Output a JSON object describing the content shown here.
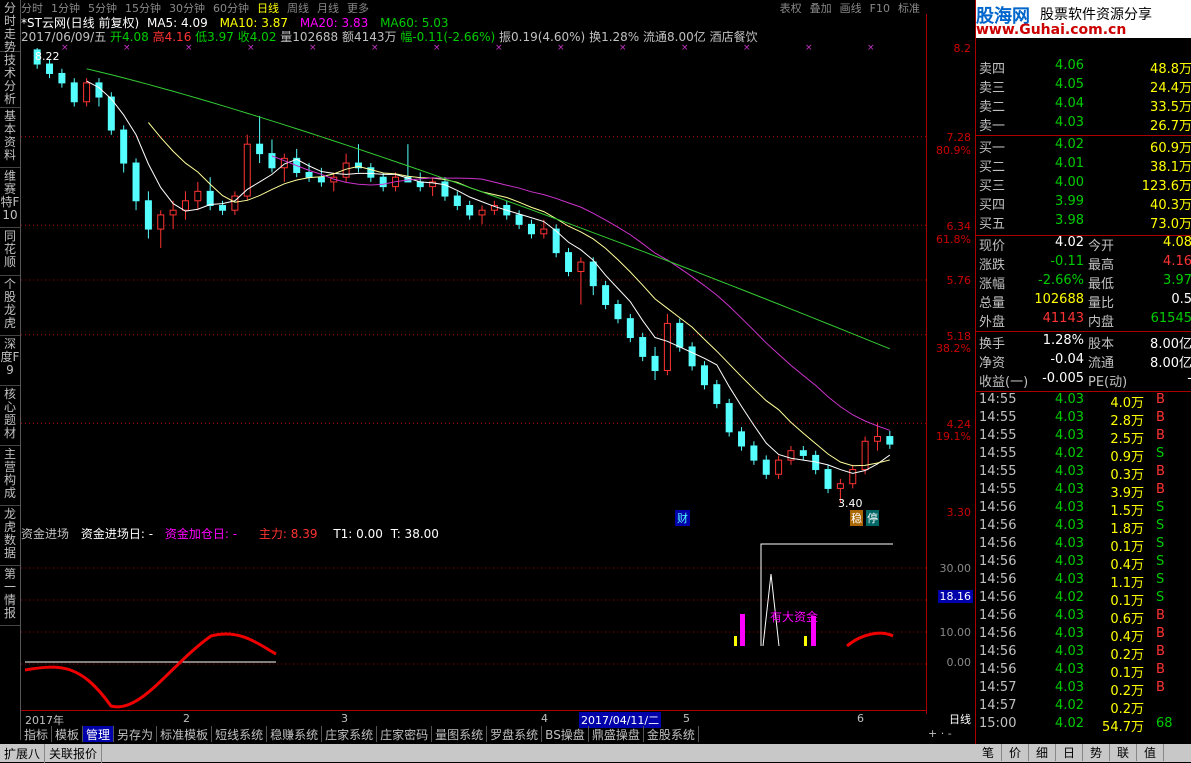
{
  "left_tabs": [
    "分时走势",
    "技术分析",
    "基本资料",
    "维赛特F10",
    "同花顺",
    "个股龙虎",
    "深度F9",
    "核心题材",
    "主营构成",
    "龙虎数据",
    "第一情报"
  ],
  "top_menu": {
    "items": [
      "分时",
      "1分钟",
      "5分钟",
      "15分钟",
      "30分钟",
      "60分钟",
      "日线",
      "周线",
      "月线",
      "更多"
    ],
    "active": "日线",
    "right": [
      "表权",
      "叠加",
      "画线",
      "F10",
      "标准"
    ]
  },
  "chart_header": {
    "line1": {
      "name": "*ST云网(日线 前复权)",
      "ma5": "MA5: 4.09",
      "ma10": "MA10: 3.87",
      "ma20": "MA20: 3.83",
      "ma60": "MA60: 5.03"
    },
    "line2": {
      "date": "2017/06/09/五",
      "open": "开4.08",
      "high": "高4.16",
      "low": "低3.97",
      "close": "收4.02",
      "vol": "量102688",
      "amount": "额4143万",
      "change": "幅-0.11(-2.66%)",
      "amp": "振0.19(4.60%)",
      "turnover": "换1.28%",
      "float": "流通8.00亿",
      "sector": "酒店餐饮"
    }
  },
  "price_axis": {
    "labels": [
      "8.2",
      "7.28",
      "80.9%",
      "6.34",
      "61.8%",
      "5.76",
      "5.18",
      "38.2%",
      "4.24",
      "19.1%",
      "3.30"
    ]
  },
  "annotations": {
    "high_label": "8.22",
    "low_label": "3.40",
    "fin_tag": "财",
    "stable_tag": "稳",
    "stop_tag": "停"
  },
  "indicator": {
    "title": "资金进场",
    "enter_day": "资金进场日: -",
    "add_day": "资金加仓日: -",
    "main": "主力: 8.39",
    "t1": "T1: 0.00",
    "t": "T: 38.00",
    "axis": [
      "30.00",
      "18.16",
      "10.00",
      "0.00"
    ],
    "annotation": "有大资金"
  },
  "x_axis": {
    "labels": [
      "2017年",
      "2",
      "3",
      "4",
      "2017/04/11/二",
      "5",
      "6"
    ],
    "period": "日线"
  },
  "bottom_tabs": [
    "指标",
    "模板",
    "管理",
    "另存为",
    "标准模板",
    "短线系统",
    "稳赚系统",
    "庄家系统",
    "庄家密码",
    "量图系统",
    "罗盘系统",
    "BS操盘",
    "鼎盛操盘",
    "金股系统"
  ],
  "bottom_tabs_selected": "管理",
  "status_bar": [
    "扩展八",
    "关联报价"
  ],
  "logo": {
    "brand": "股海网",
    "tagline": "股票软件资源分享",
    "url": "www.Guhai.com.cn"
  },
  "order_book": {
    "sell": [
      {
        "label": "卖四",
        "price": "4.06",
        "vol": "48.8万"
      },
      {
        "label": "卖三",
        "price": "4.05",
        "vol": "24.4万"
      },
      {
        "label": "卖二",
        "price": "4.04",
        "vol": "33.5万"
      },
      {
        "label": "卖一",
        "price": "4.03",
        "vol": "26.7万"
      }
    ],
    "buy": [
      {
        "label": "买一",
        "price": "4.02",
        "vol": "60.9万"
      },
      {
        "label": "买二",
        "price": "4.01",
        "vol": "38.1万"
      },
      {
        "label": "买三",
        "price": "4.00",
        "vol": "123.6万"
      },
      {
        "label": "买四",
        "price": "3.99",
        "vol": "40.3万"
      },
      {
        "label": "买五",
        "price": "3.98",
        "vol": "73.0万"
      }
    ]
  },
  "quote": [
    {
      "l1": "现价",
      "v1": "4.02",
      "l2": "今开",
      "v2": "4.08"
    },
    {
      "l1": "涨跌",
      "v1": "-0.11",
      "l2": "最高",
      "v2": "4.16"
    },
    {
      "l1": "涨幅",
      "v1": "-2.66%",
      "l2": "最低",
      "v2": "3.97"
    },
    {
      "l1": "总量",
      "v1": "102688",
      "l2": "量比",
      "v2": "0.5"
    },
    {
      "l1": "外盘",
      "v1": "41143",
      "l2": "内盘",
      "v2": "61545"
    },
    {
      "l1": "换手",
      "v1": "1.28%",
      "l2": "股本",
      "v2": "8.00亿"
    },
    {
      "l1": "净资",
      "v1": "-0.04",
      "l2": "流通",
      "v2": "8.00亿"
    },
    {
      "l1": "收益(一)",
      "v1": "-0.005",
      "l2": "PE(动)",
      "v2": "-"
    }
  ],
  "ticks": [
    {
      "t": "14:55",
      "p": "4.03",
      "v": "4.0万",
      "s": "B"
    },
    {
      "t": "14:55",
      "p": "4.03",
      "v": "2.8万",
      "s": "B"
    },
    {
      "t": "14:55",
      "p": "4.03",
      "v": "2.5万",
      "s": "B"
    },
    {
      "t": "14:55",
      "p": "4.02",
      "v": "0.9万",
      "s": "S"
    },
    {
      "t": "14:55",
      "p": "4.03",
      "v": "0.3万",
      "s": "B"
    },
    {
      "t": "14:55",
      "p": "4.03",
      "v": "3.9万",
      "s": "B"
    },
    {
      "t": "14:56",
      "p": "4.03",
      "v": "1.5万",
      "s": "S"
    },
    {
      "t": "14:56",
      "p": "4.03",
      "v": "1.8万",
      "s": "S"
    },
    {
      "t": "14:56",
      "p": "4.03",
      "v": "0.1万",
      "s": "S"
    },
    {
      "t": "14:56",
      "p": "4.03",
      "v": "0.4万",
      "s": "S"
    },
    {
      "t": "14:56",
      "p": "4.03",
      "v": "1.1万",
      "s": "S"
    },
    {
      "t": "14:56",
      "p": "4.02",
      "v": "0.1万",
      "s": "S"
    },
    {
      "t": "14:56",
      "p": "4.03",
      "v": "0.6万",
      "s": "B"
    },
    {
      "t": "14:56",
      "p": "4.03",
      "v": "0.4万",
      "s": "B"
    },
    {
      "t": "14:56",
      "p": "4.03",
      "v": "0.2万",
      "s": "B"
    },
    {
      "t": "14:56",
      "p": "4.03",
      "v": "0.1万",
      "s": "B"
    },
    {
      "t": "14:57",
      "p": "4.03",
      "v": "0.2万",
      "s": "B"
    },
    {
      "t": "14:57",
      "p": "4.02",
      "v": "0.2万",
      "s": ""
    },
    {
      "t": "15:00",
      "p": "4.02",
      "v": "54.7万",
      "s": "68"
    }
  ],
  "right_tabs": [
    "笔",
    "价",
    "细",
    "日",
    "势",
    "联",
    "值"
  ],
  "colors": {
    "up": "#f33",
    "down": "#5ff",
    "ma5": "#fff",
    "ma10": "#ff9",
    "ma20": "#c3c",
    "ma60": "#3c3",
    "grid": "#a00"
  },
  "chart_data": {
    "type": "candlestick",
    "x": [
      "2017-01-03",
      "2017-06-09"
    ],
    "ohlc": [
      [
        8.2,
        8.22,
        8.0,
        8.05
      ],
      [
        8.05,
        8.1,
        7.9,
        7.95
      ],
      [
        7.95,
        8.0,
        7.8,
        7.85
      ],
      [
        7.85,
        7.9,
        7.6,
        7.65
      ],
      [
        7.65,
        7.9,
        7.6,
        7.85
      ],
      [
        7.85,
        7.9,
        7.6,
        7.7
      ],
      [
        7.7,
        7.75,
        7.3,
        7.35
      ],
      [
        7.35,
        7.4,
        6.9,
        7.0
      ],
      [
        7.0,
        7.05,
        6.5,
        6.6
      ],
      [
        6.6,
        6.7,
        6.2,
        6.3
      ],
      [
        6.3,
        6.5,
        6.1,
        6.45
      ],
      [
        6.45,
        6.6,
        6.3,
        6.5
      ],
      [
        6.5,
        6.7,
        6.4,
        6.6
      ],
      [
        6.6,
        6.8,
        6.5,
        6.7
      ],
      [
        6.7,
        6.85,
        6.5,
        6.55
      ],
      [
        6.55,
        6.6,
        6.45,
        6.5
      ],
      [
        6.5,
        6.7,
        6.45,
        6.65
      ],
      [
        6.65,
        7.3,
        6.6,
        7.2
      ],
      [
        7.2,
        7.5,
        7.0,
        7.1
      ],
      [
        7.1,
        7.25,
        6.9,
        6.95
      ],
      [
        6.95,
        7.1,
        6.8,
        7.05
      ],
      [
        7.05,
        7.15,
        6.85,
        6.9
      ],
      [
        6.9,
        7.0,
        6.8,
        6.85
      ],
      [
        6.85,
        6.95,
        6.75,
        6.8
      ],
      [
        6.8,
        6.9,
        6.7,
        6.85
      ],
      [
        6.85,
        7.1,
        6.8,
        7.0
      ],
      [
        7.0,
        7.2,
        6.9,
        6.95
      ],
      [
        6.95,
        7.0,
        6.8,
        6.85
      ],
      [
        6.85,
        6.9,
        6.7,
        6.75
      ],
      [
        6.75,
        6.9,
        6.7,
        6.85
      ],
      [
        6.85,
        7.2,
        6.8,
        6.8
      ],
      [
        6.8,
        6.9,
        6.7,
        6.75
      ],
      [
        6.75,
        6.85,
        6.65,
        6.8
      ],
      [
        6.8,
        6.85,
        6.6,
        6.65
      ],
      [
        6.65,
        6.7,
        6.5,
        6.55
      ],
      [
        6.55,
        6.6,
        6.4,
        6.45
      ],
      [
        6.45,
        6.55,
        6.35,
        6.5
      ],
      [
        6.5,
        6.6,
        6.45,
        6.55
      ],
      [
        6.55,
        6.6,
        6.4,
        6.45
      ],
      [
        6.45,
        6.5,
        6.3,
        6.35
      ],
      [
        6.35,
        6.4,
        6.2,
        6.25
      ],
      [
        6.25,
        6.4,
        6.2,
        6.3
      ],
      [
        6.3,
        6.35,
        6.0,
        6.05
      ],
      [
        6.05,
        6.1,
        5.8,
        5.85
      ],
      [
        5.85,
        6.0,
        5.5,
        5.95
      ],
      [
        5.95,
        6.0,
        5.6,
        5.7
      ],
      [
        5.7,
        5.75,
        5.45,
        5.5
      ],
      [
        5.5,
        5.55,
        5.3,
        5.35
      ],
      [
        5.35,
        5.4,
        5.1,
        5.15
      ],
      [
        5.15,
        5.2,
        4.9,
        4.95
      ],
      [
        4.95,
        5.05,
        4.7,
        4.8
      ],
      [
        4.8,
        5.4,
        4.75,
        5.3
      ],
      [
        5.3,
        5.35,
        5.0,
        5.05
      ],
      [
        5.05,
        5.1,
        4.8,
        4.85
      ],
      [
        4.85,
        4.9,
        4.6,
        4.65
      ],
      [
        4.65,
        4.7,
        4.4,
        4.45
      ],
      [
        4.45,
        4.5,
        4.1,
        4.15
      ],
      [
        4.15,
        4.2,
        3.95,
        4.0
      ],
      [
        4.0,
        4.05,
        3.8,
        3.85
      ],
      [
        3.85,
        3.9,
        3.65,
        3.7
      ],
      [
        3.7,
        3.9,
        3.65,
        3.85
      ],
      [
        3.85,
        4.0,
        3.8,
        3.95
      ],
      [
        3.95,
        4.0,
        3.85,
        3.9
      ],
      [
        3.9,
        3.95,
        3.7,
        3.75
      ],
      [
        3.75,
        3.8,
        3.5,
        3.55
      ],
      [
        3.55,
        3.65,
        3.4,
        3.6
      ],
      [
        3.6,
        3.8,
        3.55,
        3.75
      ],
      [
        3.75,
        4.1,
        3.7,
        4.05
      ],
      [
        4.05,
        4.25,
        3.95,
        4.1
      ],
      [
        4.1,
        4.16,
        3.97,
        4.02
      ]
    ],
    "ma5": [],
    "ma10": [],
    "ma20": [],
    "ma60": [],
    "ylim": [
      3.3,
      8.22
    ]
  }
}
